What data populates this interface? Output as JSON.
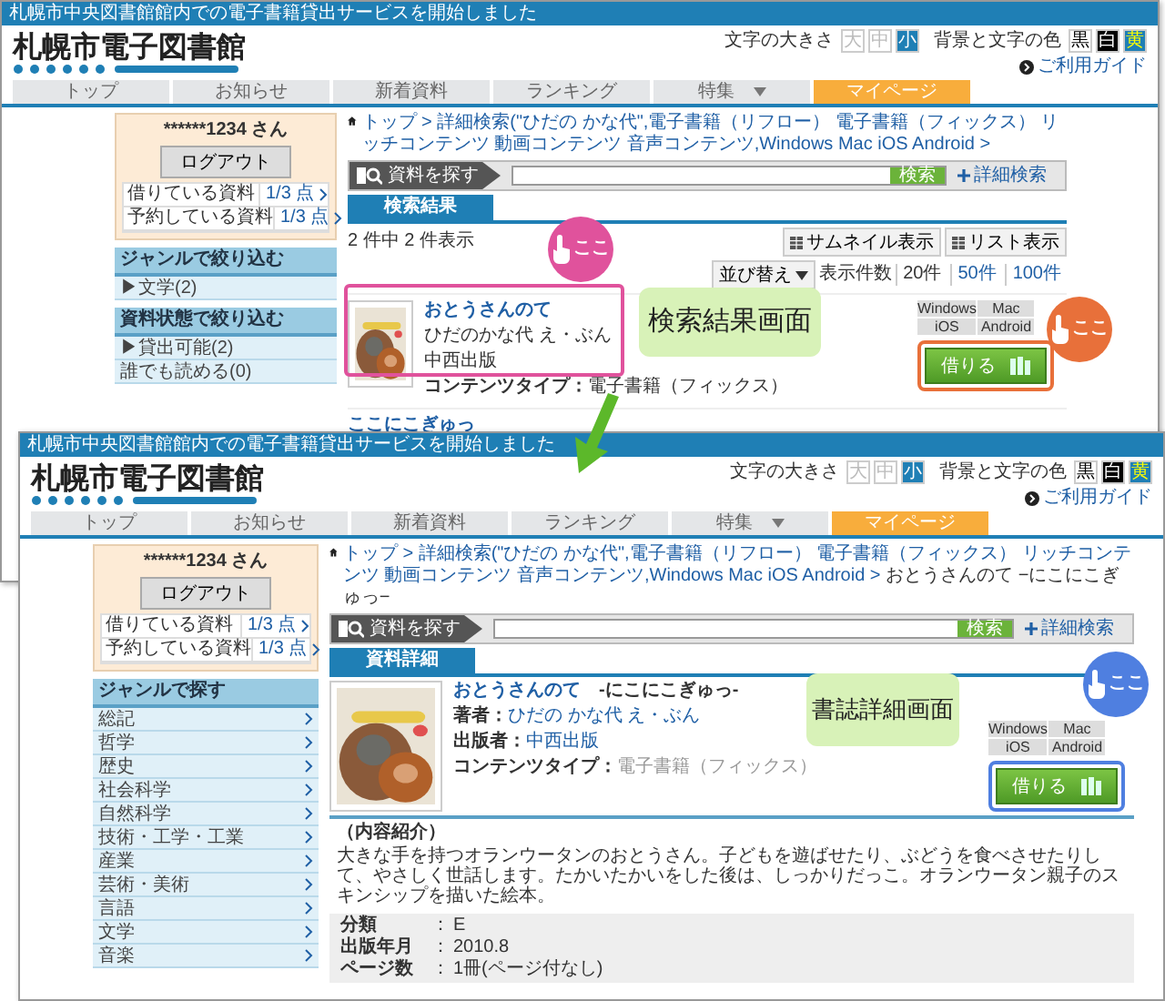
{
  "search_window": {
    "header": {
      "banner": "札幌市中央図書館館内での電子書籍貸出サービスを開始しました",
      "logo": "札幌市電子図書館",
      "font_size": {
        "label": "文字の大きさ",
        "options": [
          {
            "label": "大",
            "selected": false
          },
          {
            "label": "中",
            "selected": false
          },
          {
            "label": "小",
            "selected": true
          }
        ]
      },
      "color_theme": {
        "label": "背景と文字の色",
        "options": [
          {
            "label": "黒",
            "kind": "light"
          },
          {
            "label": "白",
            "kind": "dark"
          },
          {
            "label": "黄",
            "kind": "blue"
          }
        ]
      },
      "guide": "ご利用ガイド",
      "nav": [
        {
          "label": "トップ",
          "selected": false,
          "dropdown": false
        },
        {
          "label": "お知らせ",
          "selected": false,
          "dropdown": false
        },
        {
          "label": "新着資料",
          "selected": false,
          "dropdown": false
        },
        {
          "label": "ランキング",
          "selected": false,
          "dropdown": false
        },
        {
          "label": "特集",
          "selected": false,
          "dropdown": true
        },
        {
          "label": "マイページ",
          "selected": true,
          "dropdown": false
        }
      ]
    },
    "sidebar": {
      "user": "******1234 さん",
      "logout": "ログアウト",
      "counts": [
        {
          "label": "借りている資料",
          "count": "1/3",
          "unit": "点"
        },
        {
          "label": "予約している資料",
          "count": "1/3",
          "unit": "点"
        }
      ],
      "filters": [
        {
          "heading": "ジャンルで絞り込む",
          "items": [
            "▶文学(2)"
          ]
        },
        {
          "heading": "資料状態で絞り込む",
          "items": [
            "▶貸出可能(2)",
            "誰でも読める(0)"
          ]
        }
      ]
    },
    "breadcrumb": {
      "separator": ">",
      "links": [
        "トップ",
        "詳細検索(\"ひだの かな代\",電子書籍（リフロー） 電子書籍（フィックス） リッチコンテンツ 動画コンテンツ 音声コンテンツ,Windows Mac iOS Android"
      ]
    },
    "search": {
      "label": "資料を探す",
      "button": "検索",
      "advanced": "詳細検索"
    },
    "tab": "検索結果",
    "summary": "2 件中 2 件表示",
    "view_buttons": [
      "サムネイル表示",
      "リスト表示"
    ],
    "sort": "並び替え",
    "per_page": {
      "label": "表示件数",
      "options": [
        {
          "label": "20件",
          "selected": true
        },
        {
          "label": "50件",
          "selected": false
        },
        {
          "label": "100件",
          "selected": false
        }
      ]
    },
    "results": [
      {
        "title": "おとうさんのて",
        "author": "ひだのかな代 え・ぶん",
        "publisher": "中西出版",
        "type_label": "コンテンツタイプ：",
        "type": "電子書籍（フィックス）",
        "platforms": [
          "Windows",
          "Mac",
          "iOS",
          "Android"
        ],
        "borrow": "借りる"
      },
      {
        "title": "ここにこぎゅっ"
      }
    ],
    "overlay_label": "検索結果画面",
    "callouts": [
      {
        "text": "ここ",
        "color": "#e0529c"
      },
      {
        "text": "ここ",
        "color": "#e8703a"
      }
    ]
  },
  "detail_window": {
    "header": {
      "banner": "札幌市中央図書館館内での電子書籍貸出サービスを開始しました",
      "logo": "札幌市電子図書館",
      "font_size": {
        "label": "文字の大きさ",
        "options": [
          {
            "label": "大",
            "selected": false
          },
          {
            "label": "中",
            "selected": false
          },
          {
            "label": "小",
            "selected": true
          }
        ]
      },
      "color_theme": {
        "label": "背景と文字の色",
        "options": [
          {
            "label": "黒",
            "kind": "light"
          },
          {
            "label": "白",
            "kind": "dark"
          },
          {
            "label": "黄",
            "kind": "blue"
          }
        ]
      },
      "guide": "ご利用ガイド",
      "nav": [
        {
          "label": "トップ",
          "selected": false,
          "dropdown": false
        },
        {
          "label": "お知らせ",
          "selected": false,
          "dropdown": false
        },
        {
          "label": "新着資料",
          "selected": false,
          "dropdown": false
        },
        {
          "label": "ランキング",
          "selected": false,
          "dropdown": false
        },
        {
          "label": "特集",
          "selected": false,
          "dropdown": true
        },
        {
          "label": "マイページ",
          "selected": true,
          "dropdown": false
        }
      ]
    },
    "sidebar": {
      "user": "******1234 さん",
      "logout": "ログアウト",
      "counts": [
        {
          "label": "借りている資料",
          "count": "1/3",
          "unit": "点"
        },
        {
          "label": "予約している資料",
          "count": "1/3",
          "unit": "点"
        }
      ],
      "genre_heading": "ジャンルで探す",
      "genres": [
        "総記",
        "哲学",
        "歴史",
        "社会科学",
        "自然科学",
        "技術・工学・工業",
        "産業",
        "芸術・美術",
        "言語",
        "文学",
        "音楽"
      ]
    },
    "breadcrumb": {
      "separator": ">",
      "links": [
        "トップ",
        "詳細検索(\"ひだの かな代\",電子書籍（リフロー） 電子書籍（フィックス） リッチコンテンツ 動画コンテンツ 音声コンテンツ,Windows Mac iOS Android"
      ],
      "current": "おとうさんのて −にこにこぎゅっ−"
    },
    "search": {
      "label": "資料を探す",
      "button": "検索",
      "advanced": "詳細検索"
    },
    "tab": "資料詳細",
    "title": "おとうさんのて",
    "subtitle": "-にこにこぎゅっ-",
    "fields": [
      {
        "label": "著者：",
        "value": "ひだの かな代 え・ぶん",
        "kind": "link"
      },
      {
        "label": "出版者：",
        "value": "中西出版",
        "kind": "link"
      },
      {
        "label": "コンテンツタイプ：",
        "value": "電子書籍（フィックス）",
        "kind": "muted"
      }
    ],
    "platforms": [
      "Windows",
      "Mac",
      "iOS",
      "Android"
    ],
    "borrow": "借りる",
    "description_heading": "（内容紹介）",
    "description": "大きな手を持つオランウータンのおとうさん。子どもを遊ばせたり、ぶどうを食べさせたりして、やさしく世話します。たかいたかいをした後は、しっかりだっこ。オランウータン親子のスキンシップを描いた絵本。",
    "meta": [
      {
        "label": "分類",
        "sep": "：",
        "value": "E"
      },
      {
        "label": "出版年月",
        "sep": "：",
        "value": "2010.8"
      },
      {
        "label": "ページ数",
        "sep": "：",
        "value": "1冊(ページ付なし)"
      }
    ],
    "overlay_label": "書誌詳細画面",
    "callouts": [
      {
        "text": "ここ",
        "color": "#4f7fe0"
      }
    ]
  }
}
